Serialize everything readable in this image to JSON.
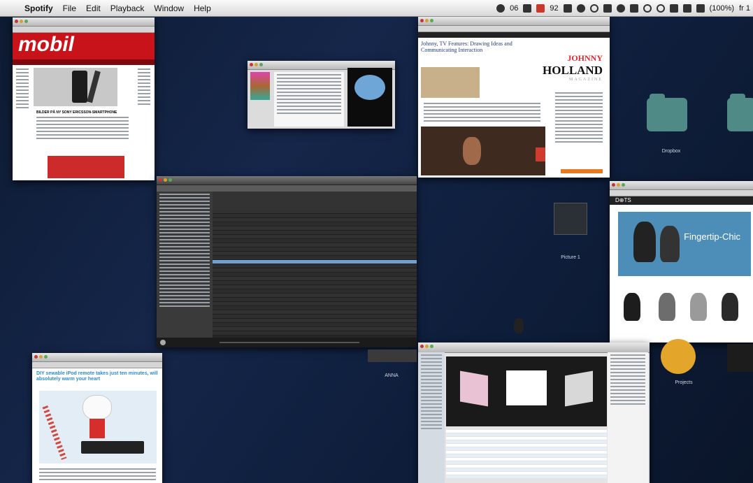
{
  "menubar": {
    "app_name": "Spotify",
    "menus": [
      "File",
      "Edit",
      "Playback",
      "Window",
      "Help"
    ],
    "status_items": [
      "06",
      "92",
      "(100%)",
      "fr 1"
    ]
  },
  "windows": {
    "mobil": {
      "logo": "mobil",
      "headline": "BILDER PÅ NY SONY ERICSSON-SMARTPHONE"
    },
    "johnny_holland": {
      "article_title": "Johnny, TV Features: Drawing Ideas and Communicating Interaction",
      "brand_line1": "JOHNNY",
      "brand_line2": "HOLLAND",
      "brand_line3": "MAGAZINE"
    },
    "dots": {
      "brand": "D⊕TS",
      "hero_text": "Fingertip-Chic"
    },
    "craft": {
      "headline": "DIY sewable iPod remote takes just ten minutes, will absolutely warm your heart"
    }
  },
  "desktop": {
    "icons": [
      {
        "label": "Dropbox"
      },
      {
        "label": "Picture 1"
      },
      {
        "label": "ANNA"
      },
      {
        "label": "Projects"
      }
    ]
  },
  "colors": {
    "mobil_red": "#c8131b",
    "spotify_highlight": "#6f9fd3",
    "folder_teal": "#4f8a86",
    "projects_orange": "#e3a52a"
  }
}
